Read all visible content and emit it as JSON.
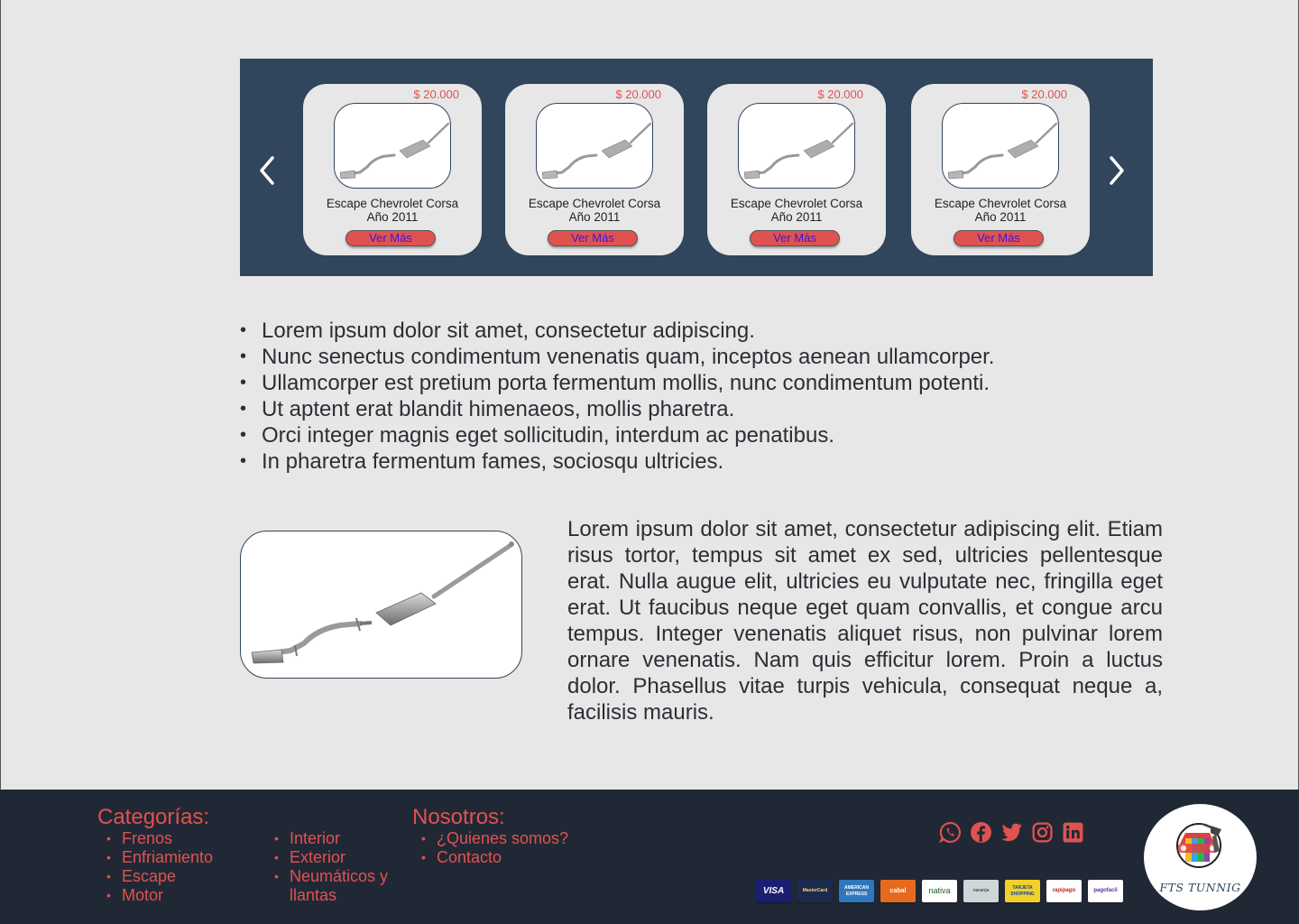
{
  "carousel": {
    "prev_icon": "chevron-left-icon",
    "next_icon": "chevron-right-icon",
    "cards": [
      {
        "price": "$ 20.000",
        "name_line1": "Escape Chevrolet Corsa",
        "name_line2": "Año 2011",
        "button": "Ver Más",
        "image_icon": "exhaust-pipe-image"
      },
      {
        "price": "$ 20.000",
        "name_line1": "Escape Chevrolet Corsa",
        "name_line2": "Año 2011",
        "button": "Ver Más",
        "image_icon": "exhaust-pipe-image"
      },
      {
        "price": "$ 20.000",
        "name_line1": "Escape Chevrolet Corsa",
        "name_line2": "Año 2011",
        "button": "Ver Más",
        "image_icon": "exhaust-pipe-image"
      },
      {
        "price": "$ 20.000",
        "name_line1": "Escape Chevrolet Corsa",
        "name_line2": "Año 2011",
        "button": "Ver Más",
        "image_icon": "exhaust-pipe-image"
      }
    ]
  },
  "features": [
    "Lorem ipsum dolor sit amet, consectetur adipiscing.",
    "Nunc senectus condimentum venenatis quam, inceptos aenean ullamcorper.",
    "Ullamcorper est pretium porta fermentum mollis, nunc condimentum potenti.",
    "Ut aptent erat blandit himenaeos, mollis pharetra.",
    "Orci integer magnis eget sollicitudin, interdum ac penatibus.",
    "In pharetra fermentum fames, sociosqu ultricies."
  ],
  "description": "Lorem ipsum dolor sit amet, consectetur adipiscing elit. Etiam risus tortor, tempus sit amet ex sed, ultricies pellentesque erat. Nulla augue elit, ultricies eu vulputate nec, fringilla eget erat. Ut faucibus neque eget quam convallis, et congue arcu tempus. Integer venenatis aliquet risus, non pulvinar lorem ornare venenatis. Nam quis efficitur lorem. Proin a luctus dolor. Phasellus vitae turpis vehicula, consequat neque a, facilisis mauris.",
  "footer": {
    "categories_title": "Categorías:",
    "categories_col1": [
      "Frenos",
      "Enfriamiento",
      "Escape",
      "Motor"
    ],
    "categories_col2": [
      "Interior",
      "Exterior",
      "Neumáticos y llantas"
    ],
    "about_title": "Nosotros:",
    "about_links": [
      "¿Quienes somos?",
      "Contacto"
    ],
    "socials": [
      "whatsapp-icon",
      "facebook-icon",
      "twitter-icon",
      "instagram-icon",
      "linkedin-icon"
    ],
    "payments": [
      "VISA",
      "MasterCard",
      "AMERICAN EXPRESS",
      "cabal",
      "nativa",
      "naranja",
      "TARJETA SHOPPING",
      "rapipago",
      "pagofacil"
    ],
    "logo_text": "FTS TUNNIG"
  },
  "colors": {
    "accent": "#e05250",
    "carousel_bg": "#31455c",
    "footer_bg": "#202835",
    "page_bg": "#e7e7e7"
  }
}
